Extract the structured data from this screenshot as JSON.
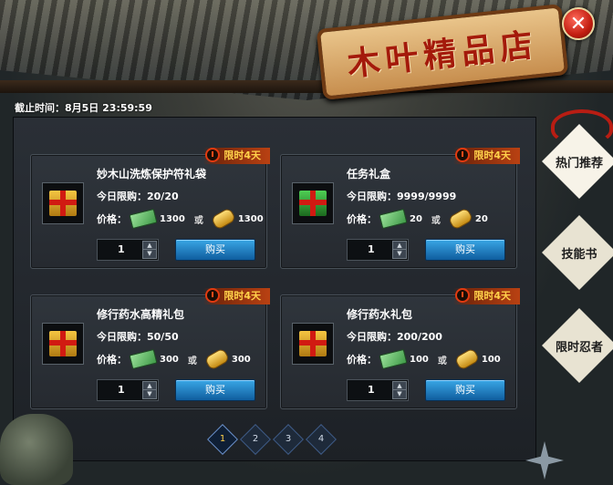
{
  "header": {
    "title": "木叶精品店",
    "deadline": "截止时间：8月5日 23:59:59",
    "close_glyph": "✕"
  },
  "labels": {
    "limit_prefix": "今日限购：",
    "price_prefix": "价格：",
    "or": "或",
    "buy": "购买",
    "spin_up": "▲",
    "spin_down": "▼"
  },
  "items": [
    {
      "name": "妙木山洗炼保护符礼袋",
      "timer": "限时4天",
      "limit": "20/20",
      "price_money": "1300",
      "price_coin": "1300",
      "qty": "1",
      "icon": "gold-gift-box-icon"
    },
    {
      "name": "任务礼盒",
      "timer": "限时4天",
      "limit": "9999/9999",
      "price_money": "20",
      "price_coin": "20",
      "qty": "1",
      "icon": "green-gift-box-icon"
    },
    {
      "name": "修行药水高精礼包",
      "timer": "限时4天",
      "limit": "50/50",
      "price_money": "300",
      "price_coin": "300",
      "qty": "1",
      "icon": "gold-gift-box-icon"
    },
    {
      "name": "修行药水礼包",
      "timer": "限时4天",
      "limit": "200/200",
      "price_money": "100",
      "price_coin": "100",
      "qty": "1",
      "icon": "gold-gift-box-icon"
    }
  ],
  "pages": [
    "1",
    "2",
    "3",
    "4"
  ],
  "current_page": "1",
  "tabs": [
    {
      "label": "热门推荐"
    },
    {
      "label": "技能书"
    },
    {
      "label": "限时忍者"
    }
  ],
  "colors": {
    "timer_text": "#ffd14a",
    "buy_button": "#1f7fc7",
    "sign_text": "#a41a0b"
  }
}
